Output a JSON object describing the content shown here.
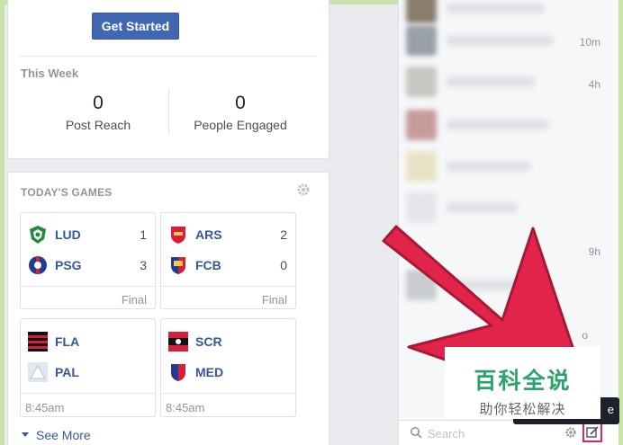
{
  "page_card": {
    "get_started_label": "Get Started",
    "section_label": "This Week",
    "stats": [
      {
        "value": "0",
        "label": "Post Reach"
      },
      {
        "value": "0",
        "label": "People Engaged"
      }
    ]
  },
  "games": {
    "title": "TODAY'S GAMES",
    "tiles": [
      {
        "home": {
          "name": "LUD",
          "score": "1"
        },
        "away": {
          "name": "PSG",
          "score": "3"
        },
        "footer": "Final"
      },
      {
        "home": {
          "name": "ARS",
          "score": "2"
        },
        "away": {
          "name": "FCB",
          "score": "0"
        },
        "footer": "Final"
      },
      {
        "home": {
          "name": "FLA",
          "score": ""
        },
        "away": {
          "name": "PAL",
          "score": ""
        },
        "footer": "8:45am"
      },
      {
        "home": {
          "name": "SCR",
          "score": ""
        },
        "away": {
          "name": "MED",
          "score": ""
        },
        "footer": "8:45am"
      }
    ],
    "see_more_label": "See More"
  },
  "chat": {
    "times": [
      "10m",
      "4h",
      "9h",
      "o"
    ],
    "search_placeholder": "Search",
    "tooltip_char": "e"
  },
  "watermark": {
    "title": "百科全说",
    "subtitle": "助你轻松解决"
  },
  "colors": {
    "accent": "#4267b2",
    "link": "#365899",
    "arrow": "#e0244a",
    "watermark_green": "#2aa26b"
  }
}
